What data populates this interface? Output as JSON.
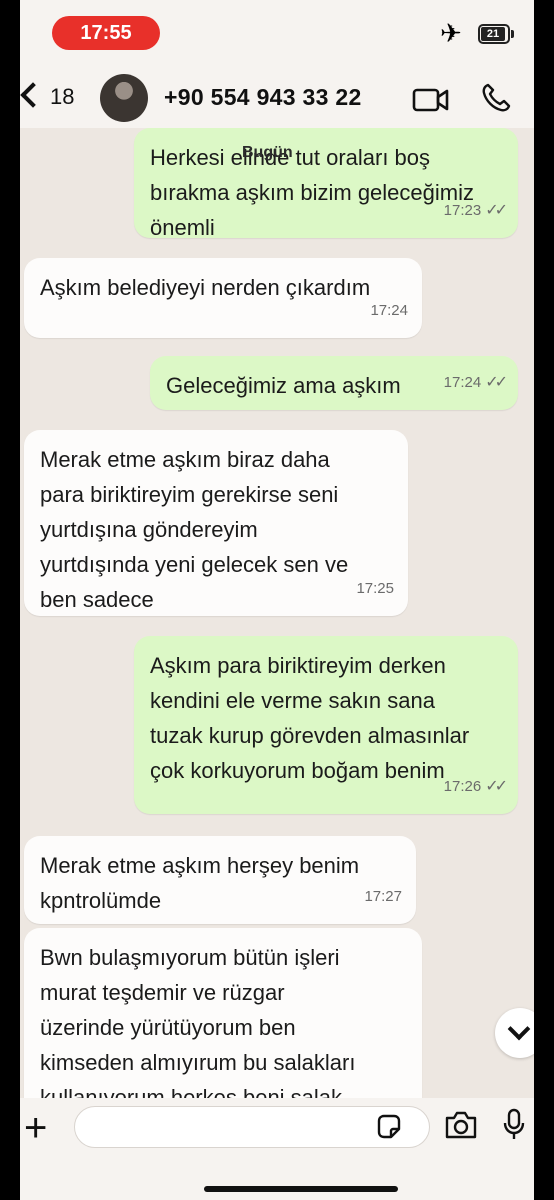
{
  "status_bar": {
    "time": "17:55",
    "battery": "21",
    "airplane_icon": "airplane-icon"
  },
  "header": {
    "back_count": "18",
    "contact": "+90 554 943 33 22"
  },
  "date_chip": "Bugün",
  "messages": [
    {
      "dir": "out",
      "text": "Herkesi elinde tut oraları boş\nbırakma aşkım bizim geleceğimiz\nönemli",
      "time": "17:23"
    },
    {
      "dir": "in",
      "text": "Aşkım belediyeyi nerden çıkardım",
      "time": "17:24"
    },
    {
      "dir": "out",
      "text": "Geleceğimiz ama aşkım",
      "time": "17:24"
    },
    {
      "dir": "in",
      "text": "Merak etme aşkım biraz daha\npara biriktireyim gerekirse seni\nyurtdışına göndereyim\nyurtdışında yeni gelecek sen ve\nben sadece",
      "time": "17:25"
    },
    {
      "dir": "out",
      "text": "Aşkım para biriktireyim derken\nkendini ele verme sakın sana\ntuzak kurup görevden almasınlar\nçok korkuyorum  boğam benim",
      "time": "17:26"
    },
    {
      "dir": "in",
      "text": "Merak etme aşkım herşey benim\nkpntrolümde",
      "time": "17:27"
    },
    {
      "dir": "in",
      "text": "Bwn bulaşmıyorum bütün işleri\nmurat teşdemir ve rüzgar\nüzerinde yürütüyorum ben\nkimseden almıyırum bu salakları\nkullanıyorum herkes beni salak",
      "time": ""
    }
  ],
  "colors": {
    "outgoing": "#dcf8c6",
    "incoming": "#fdfcfb",
    "background": "#ede7e1",
    "status_pill": "#e8302a"
  }
}
